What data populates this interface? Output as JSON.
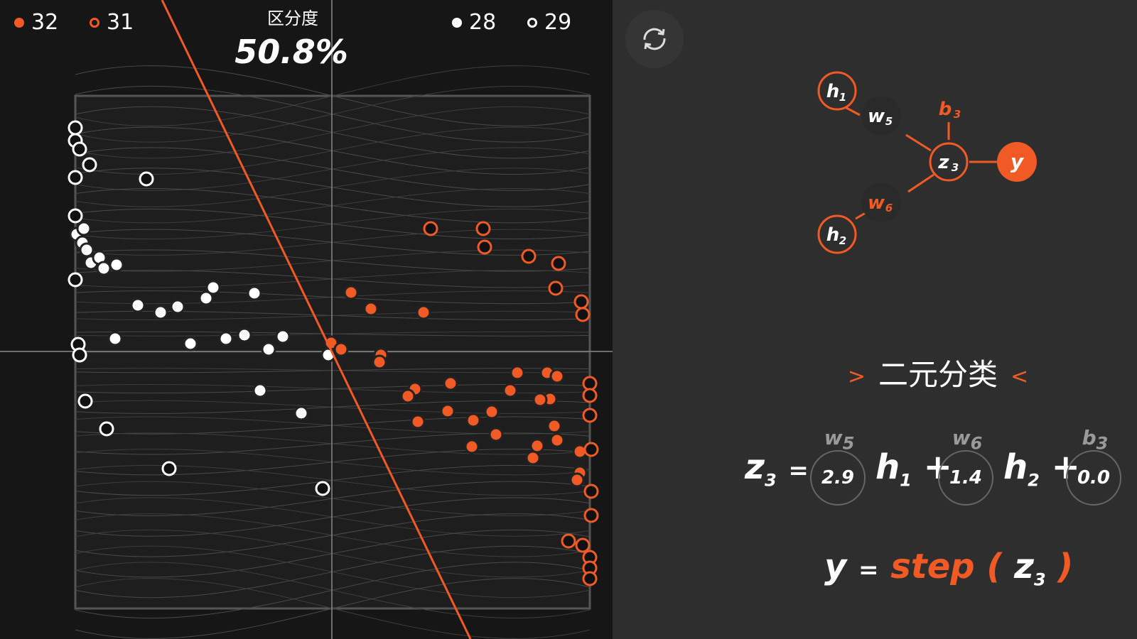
{
  "legend": {
    "orange_filled": "32",
    "orange_hollow": "31",
    "white_filled": "28",
    "white_hollow": "29"
  },
  "score": {
    "label": "区分度",
    "value": "50.8%"
  },
  "colors": {
    "accent": "#f15a24",
    "panel": "#2e2e2e",
    "plot_bg": "#161616",
    "grid": "#4a4a4a"
  },
  "refresh_icon": "refresh-icon",
  "network": {
    "h1": "h",
    "h1_sub": "1",
    "h2": "h",
    "h2_sub": "2",
    "w5": "w",
    "w5_sub": "5",
    "w6": "w",
    "w6_sub": "6",
    "b3": "b",
    "b3_sub": "3",
    "z3": "z",
    "z3_sub": "3",
    "y": "y"
  },
  "title": {
    "text": "二元分类",
    "left_arrow": ">",
    "right_arrow": "<"
  },
  "equation": {
    "lhs": "z",
    "lhs_sub": "3",
    "eq": "=",
    "w5_label": "w",
    "w5_sub": "5",
    "w5_value": "2.9",
    "h1": "h",
    "h1_sub": "1",
    "plus1": "+",
    "w6_label": "w",
    "w6_sub": "6",
    "w6_value": "1.4",
    "h2": "h",
    "h2_sub": "2",
    "plus2": "+",
    "b3_label": "b",
    "b3_sub": "3",
    "b3_value": "0.0"
  },
  "activation": {
    "y": "y",
    "eq": "=",
    "fn": "step",
    "open": "(",
    "z": "z",
    "z_sub": "3",
    "close": ")"
  }
}
